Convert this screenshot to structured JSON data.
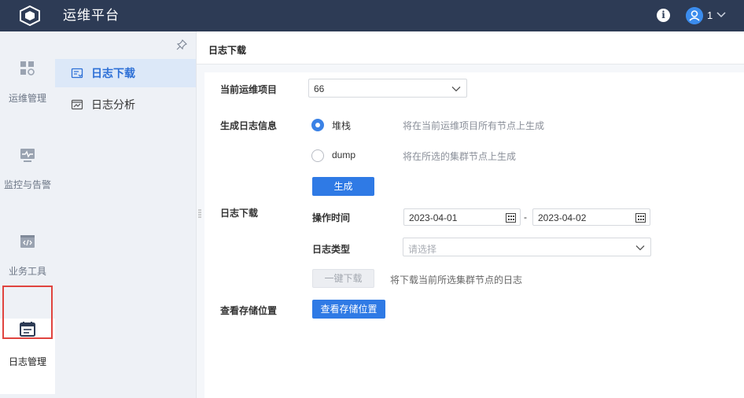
{
  "app": {
    "title": "运维平台",
    "user": "1"
  },
  "rail": {
    "items": [
      {
        "label": "运维管理",
        "icon": "dashboard-icon"
      },
      {
        "label": "监控与告警",
        "icon": "monitor-icon"
      },
      {
        "label": "业务工具",
        "icon": "code-icon"
      },
      {
        "label": "日志管理",
        "icon": "log-icon",
        "active": true
      }
    ]
  },
  "subnav": {
    "items": [
      {
        "label": "日志下载",
        "icon": "log-download-icon",
        "active": true
      },
      {
        "label": "日志分析",
        "icon": "log-analysis-icon"
      }
    ]
  },
  "page": {
    "title": "日志下载"
  },
  "form": {
    "project_label": "当前运维项目",
    "project_value": "66",
    "gen_label": "生成日志信息",
    "opt_stack": "堆栈",
    "opt_stack_hint": "将在当前运维项目所有节点上生成",
    "opt_dump": "dump",
    "opt_dump_hint": "将在所选的集群节点上生成",
    "gen_button": "生成",
    "download_label": "日志下载",
    "op_time_label": "操作时间",
    "date_start": "2023-04-01",
    "date_sep": "-",
    "date_end": "2023-04-02",
    "log_type_label": "日志类型",
    "log_type_placeholder": "请选择",
    "one_click_button": "一键下载",
    "one_click_hint": "将下载当前所选集群节点的日志",
    "storage_label": "查看存储位置",
    "storage_button": "查看存储位置"
  },
  "colors": {
    "topbar": "#2d3b55",
    "accent": "#2f7ae5",
    "highlight": "#e0443f"
  }
}
